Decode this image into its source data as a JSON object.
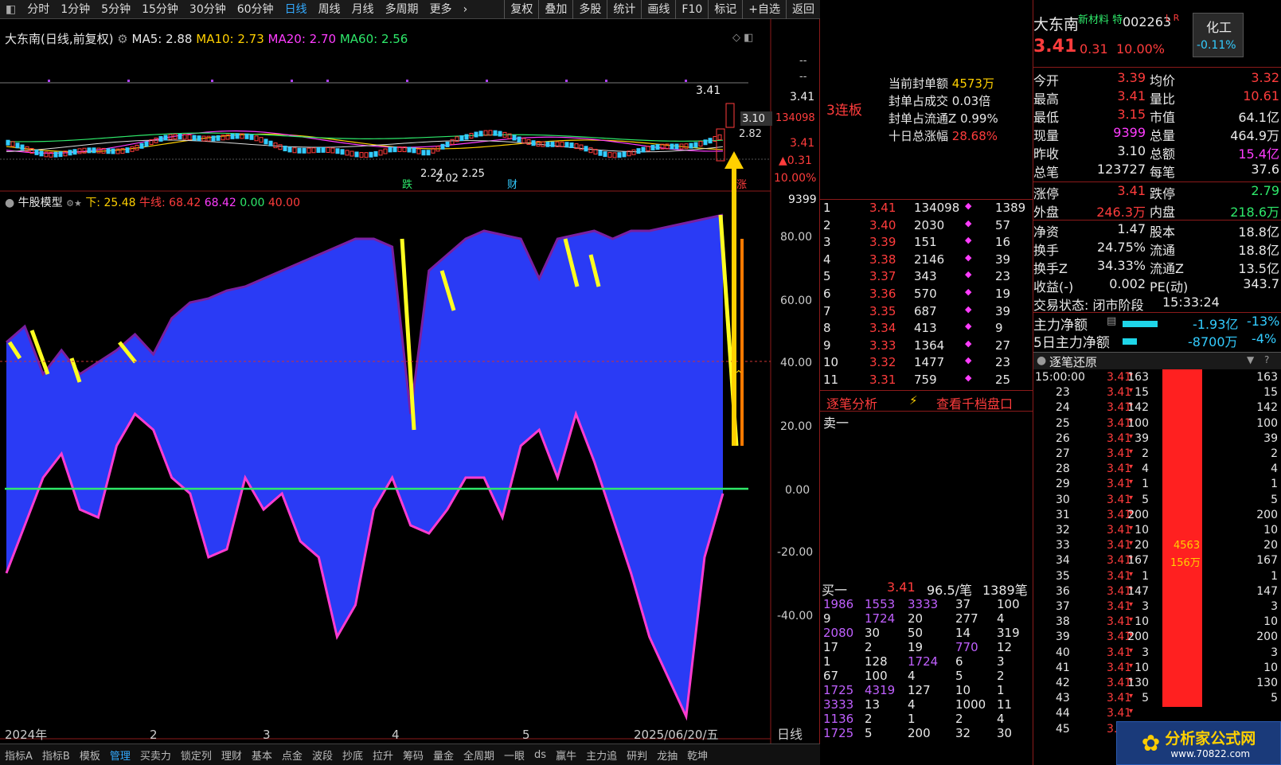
{
  "toolbar": {
    "items": [
      "分时",
      "1分钟",
      "5分钟",
      "15分钟",
      "30分钟",
      "60分钟",
      "日线",
      "周线",
      "月线",
      "多周期",
      "更多"
    ],
    "right": [
      "复权",
      "叠加",
      "多股",
      "统计",
      "画线",
      "F10",
      "标记",
      "+自选",
      "返回"
    ]
  },
  "chart": {
    "title": "大东南(日线,前复权)",
    "ma5": "MA5: 2.88",
    "ma10": "MA10: 2.73",
    "ma20": "MA20: 2.70",
    "ma60": "MA60: 2.56",
    "price_labels": {
      "hi": "3.41",
      "close": "3.41",
      "prev": "3.10",
      "p282": "2.82",
      "p341b": "3.41",
      "chg": "▲0.31",
      "pct": "10.00%",
      "vol": "134098",
      "vol2": "9399",
      "dash1": "--",
      "dash2": "--"
    },
    "low_label": "2.24",
    "low_label2": "2.02",
    "low_label3": "2.25",
    "tag_die": "跌",
    "tag_cai": "财",
    "tag_zhang": "涨"
  },
  "indicator": {
    "name": "牛股模型",
    "down": "下: 25.48",
    "niu": "牛线: 68.42",
    "v1": "68.42",
    "v2": "0.00",
    "v3": "40.00",
    "ticks": [
      "80.00",
      "60.00",
      "40.00",
      "20.00",
      "0.00",
      "-20.00",
      "-40.00"
    ]
  },
  "xaxis": {
    "labels": [
      "2024年",
      "2",
      "3",
      "4",
      "5",
      "2025/06/20/五"
    ],
    "period": "日线"
  },
  "bottom_tabs": [
    "指标A",
    "指标B",
    "模板",
    "管理",
    "买卖力",
    "锁定列",
    "理财",
    "基本",
    "点金",
    "波段",
    "抄底",
    "拉升",
    "筹码",
    "量金",
    "全周期",
    "一眼",
    "ds",
    "赢牛",
    "主力追",
    "研判",
    "龙抽",
    "乾坤"
  ],
  "mid": {
    "lianban": "3连板",
    "feng": [
      {
        "k": "当前封单额",
        "v": "4573万"
      },
      {
        "k": "封单占成交",
        "v": "0.03倍"
      },
      {
        "k": "封单占流通Z",
        "v": "0.99%"
      },
      {
        "k": "十日总涨幅",
        "v": "28.68%"
      }
    ],
    "orders": [
      [
        "1",
        "3.41",
        "134098",
        "1389"
      ],
      [
        "2",
        "3.40",
        "2030",
        "57"
      ],
      [
        "3",
        "3.39",
        "151",
        "16"
      ],
      [
        "4",
        "3.38",
        "2146",
        "39"
      ],
      [
        "5",
        "3.37",
        "343",
        "23"
      ],
      [
        "6",
        "3.36",
        "570",
        "19"
      ],
      [
        "7",
        "3.35",
        "687",
        "39"
      ],
      [
        "8",
        "3.34",
        "413",
        "9"
      ],
      [
        "9",
        "3.33",
        "1364",
        "27"
      ],
      [
        "10",
        "3.32",
        "1477",
        "23"
      ],
      [
        "11",
        "3.31",
        "759",
        "25"
      ]
    ],
    "links": [
      "逐笔分析",
      "查看千档盘口"
    ],
    "sell1": "卖一",
    "buy1": {
      "k": "买一",
      "p": "3.41",
      "avg": "96.5/笔",
      "n": "1389笔"
    },
    "queue": [
      [
        "1986",
        "1553",
        "3333",
        "37",
        "100"
      ],
      [
        "9",
        "1724",
        "20",
        "277",
        "4"
      ],
      [
        "2080",
        "30",
        "50",
        "14",
        "319"
      ],
      [
        "17",
        "2",
        "19",
        "770",
        "12"
      ],
      [
        "1",
        "128",
        "1724",
        "6",
        "3"
      ],
      [
        "67",
        "100",
        "4",
        "5",
        "2"
      ],
      [
        "1725",
        "4319",
        "127",
        "10",
        "1"
      ],
      [
        "3333",
        "13",
        "4",
        "1000",
        "11"
      ],
      [
        "1136",
        "2",
        "1",
        "2",
        "4"
      ],
      [
        "1725",
        "5",
        "200",
        "32",
        "30"
      ]
    ]
  },
  "right": {
    "name": "大东南",
    "tags": "新材料 特",
    "code": "002263",
    "lr": "L R",
    "sector": "化工",
    "sector_chg": "-0.11%",
    "price": "3.41",
    "chg": "0.31",
    "pct": "10.00%",
    "stats": [
      [
        "今开",
        "3.39",
        "均价",
        "3.32"
      ],
      [
        "最高",
        "3.41",
        "量比",
        "10.61"
      ],
      [
        "最低",
        "3.15",
        "市值",
        "64.1亿"
      ],
      [
        "现量",
        "9399",
        "总量",
        "464.9万"
      ],
      [
        "昨收",
        "3.10",
        "总额",
        "15.4亿"
      ],
      [
        "总笔",
        "123727",
        "每笔",
        "37.6"
      ]
    ],
    "limit": [
      [
        "涨停",
        "3.41",
        "跌停",
        "2.79"
      ],
      [
        "外盘",
        "246.3万",
        "内盘",
        "218.6万"
      ]
    ],
    "fund": [
      [
        "净资",
        "1.47",
        "股本",
        "18.8亿"
      ],
      [
        "换手",
        "24.75%",
        "流通",
        "18.8亿"
      ],
      [
        "换手Z",
        "34.33%",
        "流通Z",
        "13.5亿"
      ],
      [
        "收益(-)",
        "0.002",
        "PE(动)",
        "343.7"
      ]
    ],
    "state": "交易状态: 闭市阶段",
    "time": "15:33:24",
    "main1": {
      "k": "主力净额",
      "v": "-1.93亿",
      "p": "-13%"
    },
    "main5": {
      "k": "5日主力净额",
      "v": "-8700万",
      "p": "-4%"
    },
    "tick_title": "逐笔还原",
    "tick_time": "15:00:00",
    "ticks": [
      [
        "",
        "3.41",
        "163",
        "163"
      ],
      [
        "23",
        "3.41",
        "15",
        "15"
      ],
      [
        "24",
        "3.41",
        "142",
        "142"
      ],
      [
        "25",
        "3.41",
        "100",
        "100"
      ],
      [
        "26",
        "3.41",
        "39",
        "39"
      ],
      [
        "27",
        "3.41",
        "2",
        "2"
      ],
      [
        "28",
        "3.41",
        "4",
        "4"
      ],
      [
        "29",
        "3.41",
        "1",
        "1"
      ],
      [
        "30",
        "3.41",
        "5",
        "5"
      ],
      [
        "31",
        "3.41",
        "200",
        "200"
      ],
      [
        "32",
        "3.41",
        "10",
        "10"
      ],
      [
        "33",
        "3.41",
        "20",
        "20"
      ],
      [
        "34",
        "3.41",
        "167",
        "167"
      ],
      [
        "35",
        "3.41",
        "1",
        "1"
      ],
      [
        "36",
        "3.41",
        "147",
        "147"
      ],
      [
        "37",
        "3.41",
        "3",
        "3"
      ],
      [
        "38",
        "3.41",
        "10",
        "10"
      ],
      [
        "39",
        "3.41",
        "200",
        "200"
      ],
      [
        "40",
        "3.41",
        "3",
        "3"
      ],
      [
        "41",
        "3.41",
        "10",
        "10"
      ],
      [
        "42",
        "3.41",
        "130",
        "130"
      ],
      [
        "43",
        "3.41",
        "5",
        "5"
      ],
      [
        "44",
        "3.41",
        "",
        ""
      ],
      [
        "45",
        "3.41",
        "",
        ""
      ]
    ],
    "bigorder": "4563",
    "bigorder2": "156万"
  },
  "logo": {
    "text": "分析家公式网",
    "url": "www.70822.com"
  }
}
